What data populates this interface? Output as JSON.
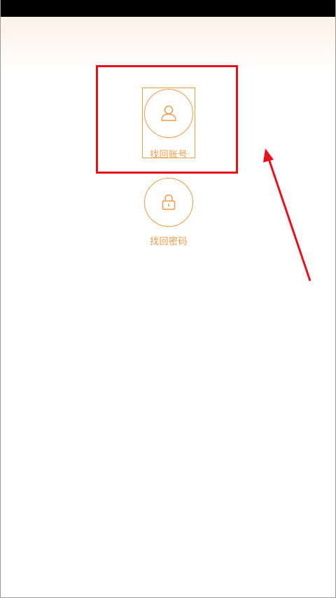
{
  "status_bar": {},
  "options": {
    "find_account": {
      "label": "找回账号",
      "icon": "user-icon",
      "selected": true
    },
    "find_password": {
      "label": "找回密码",
      "icon": "lock-icon"
    }
  },
  "annotation": {
    "highlight_color": "#e8101b",
    "arrow_color": "#e8101b"
  },
  "colors": {
    "accent": "#ee9b49",
    "selection_border": "#e3a23a",
    "status_bar": "#000000"
  }
}
